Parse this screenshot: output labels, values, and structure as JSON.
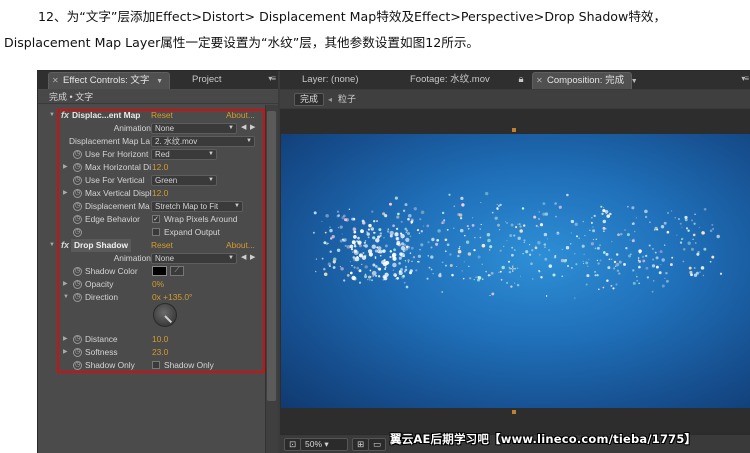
{
  "caption": {
    "line1": "12、为“文字”层添加Effect>Distort> Displacement Map特效及Effect>Perspective>Drop Shadow特效，",
    "line2": "Displacement Map Layer属性一定要设置为“水纹”层，其他参数设置如图12所示。"
  },
  "left_panel": {
    "tab_effect_controls": "Effect Controls: 文字",
    "tab_project": "Project",
    "breadcrumb": "完成 • 文字",
    "displacement": {
      "name": "Displac...ent Map",
      "reset": "Reset",
      "about": "About...",
      "animation_presets_label": "Animation Presets:",
      "animation_presets_value": "None",
      "map_layer_label": "Displacement Map La",
      "map_layer_value": "2. 水纹.mov",
      "use_horizontal_label": "Use For Horizont",
      "use_horizontal_value": "Red",
      "max_horizontal_label": "Max Horizontal Di",
      "max_horizontal_value": "12.0",
      "use_vertical_label": "Use For Vertical",
      "use_vertical_value": "Green",
      "max_vertical_label": "Max Vertical Displ",
      "max_vertical_value": "12.0",
      "placement_label": "Displacement Ma",
      "placement_value": "Stretch Map to Fit",
      "edge_behavior_label": "Edge Behavior",
      "wrap_pixels": "Wrap Pixels Around",
      "expand_output": "Expand Output"
    },
    "drop_shadow": {
      "name": "Drop Shadow",
      "reset": "Reset",
      "about": "About...",
      "animation_presets_label": "Animation Presets:",
      "animation_presets_value": "None",
      "shadow_color_label": "Shadow Color",
      "shadow_color": "#000000",
      "opacity_label": "Opacity",
      "opacity_value": "0%",
      "direction_label": "Direction",
      "direction_value": "0x +135.0°",
      "distance_label": "Distance",
      "distance_value": "10.0",
      "softness_label": "Softness",
      "softness_value": "23.0",
      "shadow_only_label": "Shadow Only",
      "shadow_only_check": "Shadow Only"
    }
  },
  "right_panel": {
    "tab_layer": "Layer: (none)",
    "tab_footage": "Footage: 水纹.mov",
    "tab_composition": "Composition: 完成",
    "btn_done": "完成",
    "crumb_particles": "粒子",
    "zoom": "50%",
    "watermark": "翼云AE后期学习吧【www.lineco.com/tieba/1775】"
  },
  "colors": {
    "reset_orange": "#d49c2d",
    "highlight_red": "#d01010",
    "comp_blue": "#1f6fb8"
  }
}
